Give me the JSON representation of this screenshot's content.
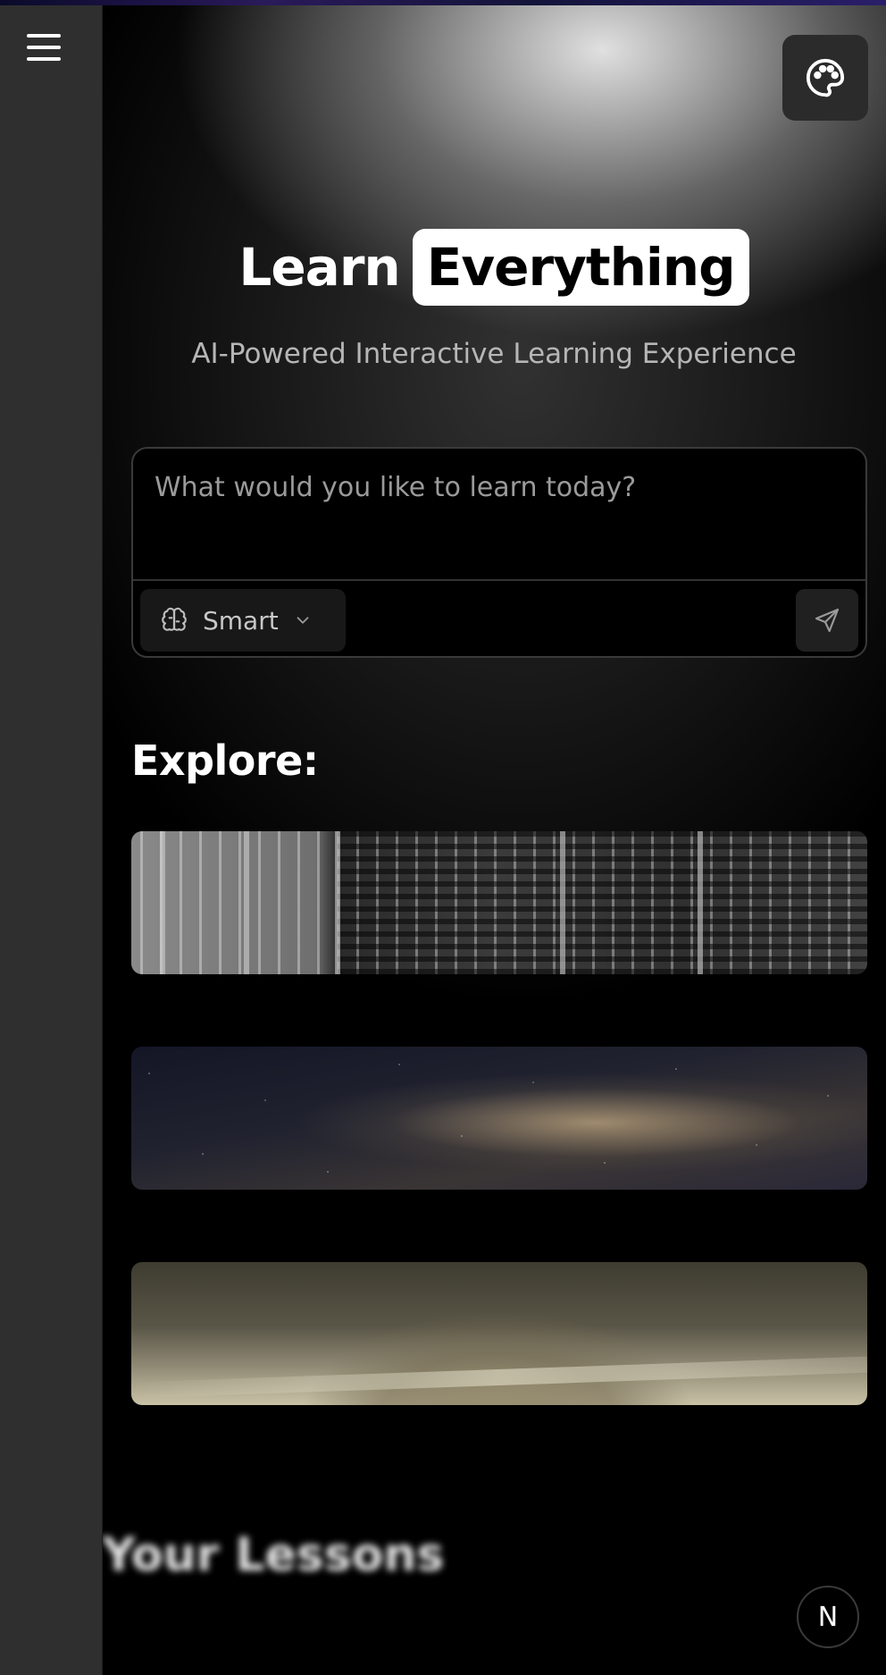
{
  "header": {
    "title_word1": "Learn",
    "title_word2": "Everything",
    "subtitle": "AI-Powered Interactive Learning Experience"
  },
  "sidebar": {
    "menu_icon": "hamburger-menu-icon"
  },
  "toolbar": {
    "theme_icon": "palette-icon"
  },
  "prompt": {
    "placeholder": "What would you like to learn today?",
    "value": "",
    "mode_icon": "brain-icon",
    "mode_selected": "Smart",
    "dropdown_icon": "chevron-down-icon",
    "send_icon": "send-icon"
  },
  "explore": {
    "heading": "Explore:",
    "cards": [
      {
        "image": "vintage-computer-panel-image"
      },
      {
        "image": "milky-way-night-sky-image"
      },
      {
        "image": "sepia-historical-photo-image"
      }
    ]
  },
  "lessons": {
    "heading": "Your Lessons"
  },
  "badge": {
    "letter": "N"
  },
  "colors": {
    "background": "#000000",
    "sidebar": "#2f2f2f",
    "accent": "#ffffff"
  }
}
